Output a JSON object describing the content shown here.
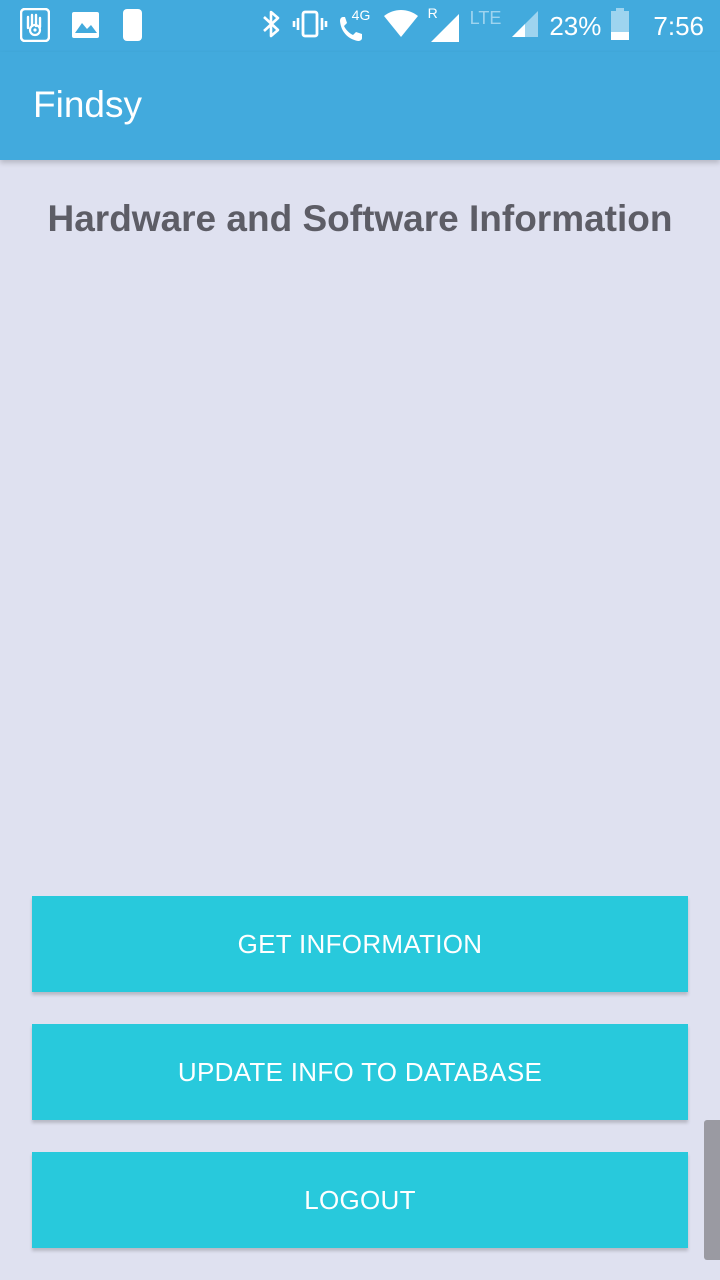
{
  "status_bar": {
    "left_icons": [
      "hand-app-icon",
      "gallery-icon",
      "moon-app-icon"
    ],
    "right_icons": [
      "bluetooth-icon",
      "vibrate-icon",
      "volte-call-icon",
      "wifi-icon",
      "signal-icon",
      "signal-icon"
    ],
    "network_4g": "4G",
    "roaming": "R",
    "network_lte": "LTE",
    "battery_percent": "23%",
    "time": "7:56"
  },
  "app_bar": {
    "title": "Findsy"
  },
  "main": {
    "heading": "Hardware and Software Information"
  },
  "buttons": {
    "get_information": "GET INFORMATION",
    "update_info": "UPDATE INFO TO DATABASE",
    "logout": "LOGOUT"
  },
  "colors": {
    "primary": "#42aadd",
    "accent_button": "#28c9dc",
    "background": "#dfe1f0",
    "heading_text": "#5d5d66"
  }
}
